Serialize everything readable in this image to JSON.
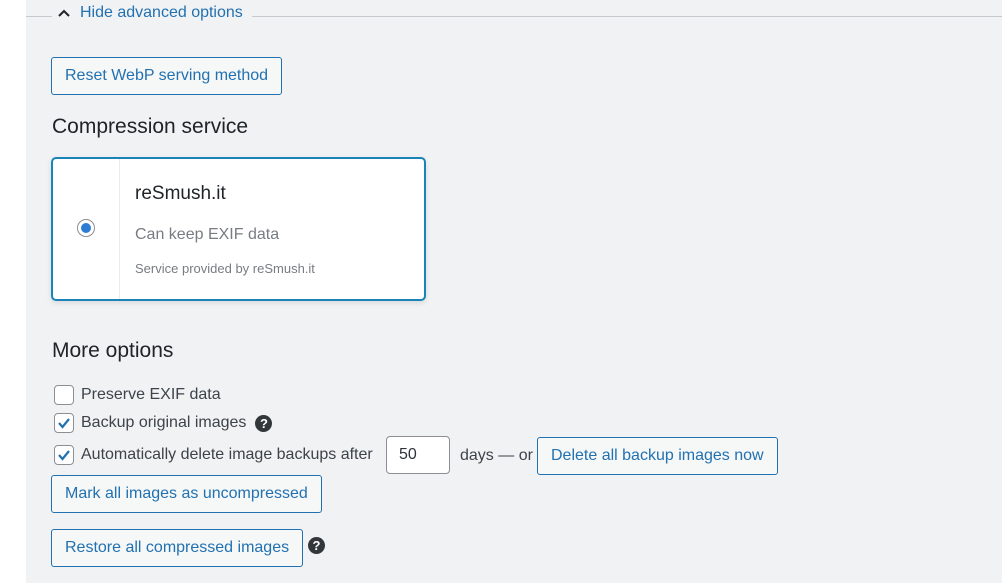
{
  "advanced_toggle": {
    "label": "Hide advanced options",
    "icon": "chevron-up-icon"
  },
  "buttons": {
    "reset_webp": "Reset WebP serving method",
    "delete_backups": "Delete all backup images now",
    "mark_uncompressed": "Mark all images as uncompressed",
    "restore_compressed": "Restore all compressed images"
  },
  "compression_service": {
    "heading": "Compression service",
    "options": [
      {
        "name": "reSmush.it",
        "description": "Can keep EXIF data",
        "note": "Service provided by reSmush.it",
        "selected": true
      }
    ]
  },
  "more_options": {
    "heading": "More options",
    "preserve_exif": {
      "label": "Preserve EXIF data",
      "checked": false
    },
    "backup_originals": {
      "label": "Backup original images",
      "checked": true,
      "help_icon": "question-circle-icon"
    },
    "auto_delete": {
      "label": "Automatically delete image backups after",
      "checked": true,
      "days_value": "50",
      "suffix": "days — or"
    },
    "restore_help_icon": "question-circle-icon"
  },
  "colors": {
    "accent": "#2271b1",
    "card_border": "#1a84b8",
    "radio_dot": "#2c7cd1",
    "page_bg": "#f1f2f4"
  }
}
